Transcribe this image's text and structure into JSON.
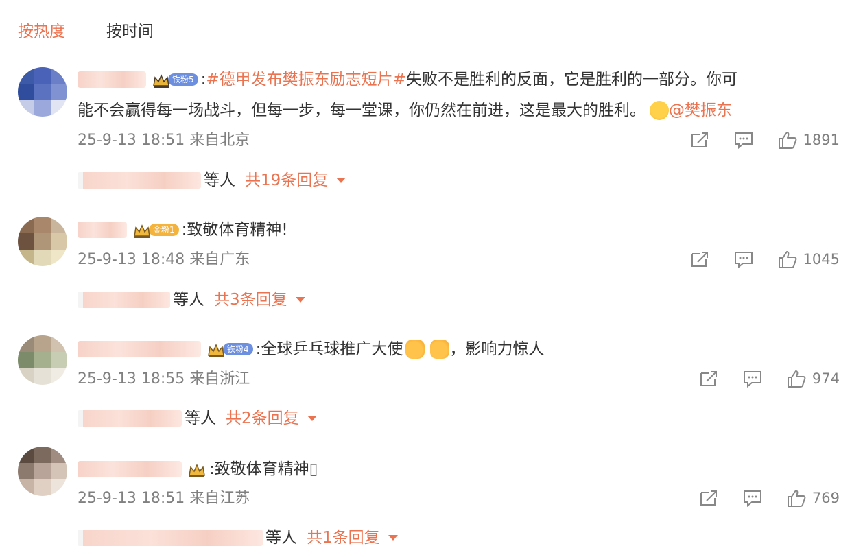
{
  "tabs": [
    {
      "label": "按热度",
      "active": true
    },
    {
      "label": "按时间",
      "active": false
    }
  ],
  "comments": [
    {
      "badge_text": "铁粉5",
      "hashtag": "#德甲发布樊振东励志短片#",
      "text_a": " 失败不是胜利的反面，它是胜利的一部分。你可",
      "text_b": "能不会赢得每一场战斗，但每一步，每一堂课，你仍然在前进，这是最大的胜利。",
      "mention": "@樊振东",
      "time": "25-9-13 18:51 来自北京",
      "likes": "1891",
      "reply_who": "等人",
      "reply_count": "共19条回复"
    },
    {
      "badge_text": "金粉1",
      "text_a": ":致敬体育精神!",
      "time": "25-9-13 18:48 来自广东",
      "likes": "1045",
      "reply_who": "等人",
      "reply_count": "共3条回复"
    },
    {
      "badge_text": "铁粉4",
      "text_a": ":全球乒乓球推广大使",
      "text_b": "，影响力惊人",
      "time": "25-9-13 18:55 来自浙江",
      "likes": "974",
      "reply_who": "等人",
      "reply_count": "共2条回复"
    },
    {
      "text_a": ":致敬体育精神▯",
      "time": "25-9-13 18:51 来自江苏",
      "likes": "769",
      "reply_who": "等人",
      "reply_count": "共1条回复"
    }
  ],
  "icons": {
    "share": "share-icon",
    "comment": "comment-icon",
    "like": "thumbs-up-icon",
    "crown": "crown-icon",
    "thumbs_emoji": "thumbs-up-emoji",
    "emoji": "smiley-emoji"
  },
  "colors": {
    "accent": "#eb7350",
    "text": "#333333",
    "meta": "#808080"
  }
}
